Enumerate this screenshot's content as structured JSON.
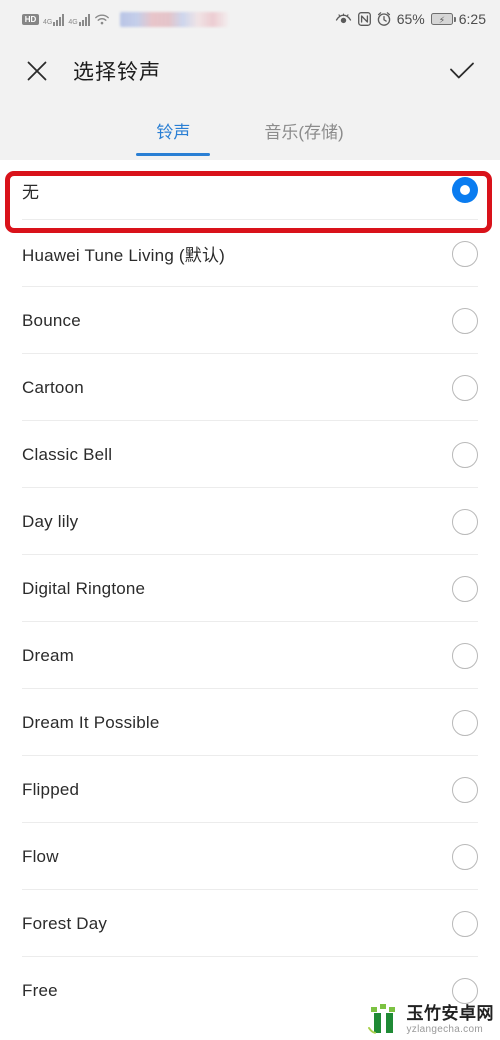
{
  "statusbar": {
    "hd_badge": "HD",
    "sim1_gen": "4G",
    "sim2_gen": "4G",
    "wifi_icon": "wifi-icon",
    "carrier_blurred": "",
    "eye_comfort_icon": "eye-comfort-icon",
    "nfc_icon": "nfc-icon",
    "alarm_icon": "alarm-clock-icon",
    "battery_percent": "65%",
    "battery_icon": "battery-charging-icon",
    "time": "6:25"
  },
  "appbar": {
    "close_icon": "close-icon",
    "title": "选择铃声",
    "confirm_icon": "check-icon"
  },
  "tabs": [
    {
      "label": "铃声",
      "active": true
    },
    {
      "label": "音乐(存储)",
      "active": false
    }
  ],
  "colors": {
    "accent": "#2a7fd4",
    "radio_selected": "#0a7cf0",
    "annotation": "#d9121a",
    "header_bg": "#f2f2f2",
    "divider": "#ececec"
  },
  "ringtones": [
    {
      "label": "无",
      "selected": true
    },
    {
      "label": "Huawei Tune Living (默认)",
      "selected": false
    },
    {
      "label": "Bounce",
      "selected": false
    },
    {
      "label": "Cartoon",
      "selected": false
    },
    {
      "label": "Classic Bell",
      "selected": false
    },
    {
      "label": "Day lily",
      "selected": false
    },
    {
      "label": "Digital Ringtone",
      "selected": false
    },
    {
      "label": "Dream",
      "selected": false
    },
    {
      "label": "Dream It Possible",
      "selected": false
    },
    {
      "label": "Flipped",
      "selected": false
    },
    {
      "label": "Flow",
      "selected": false
    },
    {
      "label": "Forest Day",
      "selected": false
    },
    {
      "label": "Free",
      "selected": false
    }
  ],
  "watermark": {
    "name": "玉竹安卓网",
    "url": "yzlangecha.com"
  }
}
